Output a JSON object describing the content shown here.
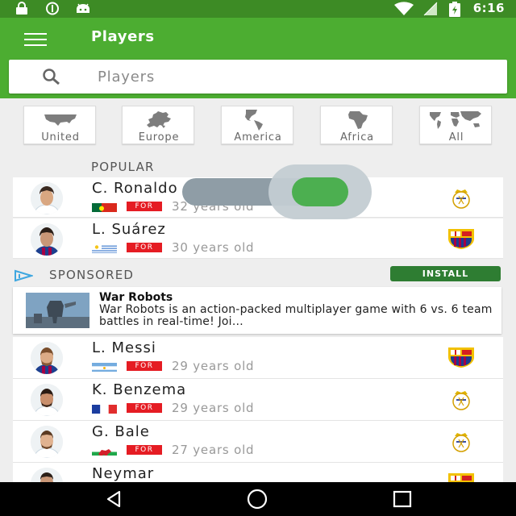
{
  "status_bar": {
    "time": "6:16"
  },
  "app_bar": {
    "title": "Players"
  },
  "search": {
    "placeholder": "Players",
    "value": ""
  },
  "regions": [
    {
      "label": "United"
    },
    {
      "label": "Europe"
    },
    {
      "label": "America"
    },
    {
      "label": "Africa"
    },
    {
      "label": "All"
    }
  ],
  "popular": {
    "header": "POPULAR",
    "players": [
      {
        "name": "C. Ronaldo",
        "position": "FOR",
        "age": "32 years old",
        "flag": "portugal",
        "club": "real-madrid"
      },
      {
        "name": "L. Suárez",
        "position": "FOR",
        "age": "30 years old",
        "flag": "uruguay",
        "club": "fc-barcelona"
      }
    ]
  },
  "sponsored": {
    "label": "SPONSORED",
    "install_label": "INSTALL",
    "ad_title": "War Robots",
    "ad_description": "War Robots is an action-packed multiplayer game with 6 vs. 6 team battles in real-time! Joi…"
  },
  "more_players": [
    {
      "name": "L. Messi",
      "position": "FOR",
      "age": "29 years old",
      "flag": "argentina",
      "club": "fc-barcelona"
    },
    {
      "name": "K. Benzema",
      "position": "FOR",
      "age": "29 years old",
      "flag": "france",
      "club": "real-madrid"
    },
    {
      "name": "G. Bale",
      "position": "FOR",
      "age": "27 years old",
      "flag": "wales",
      "club": "real-madrid"
    },
    {
      "name": "Neymar",
      "position": "",
      "age": "",
      "flag": "",
      "club": "fc-barcelona"
    }
  ],
  "colors": {
    "status_bar": "#3d8b25",
    "app_bar": "#4cad31",
    "position_badge": "#e51c23",
    "install_button": "#2e7d32",
    "toggle_knob": "#4caf50"
  }
}
